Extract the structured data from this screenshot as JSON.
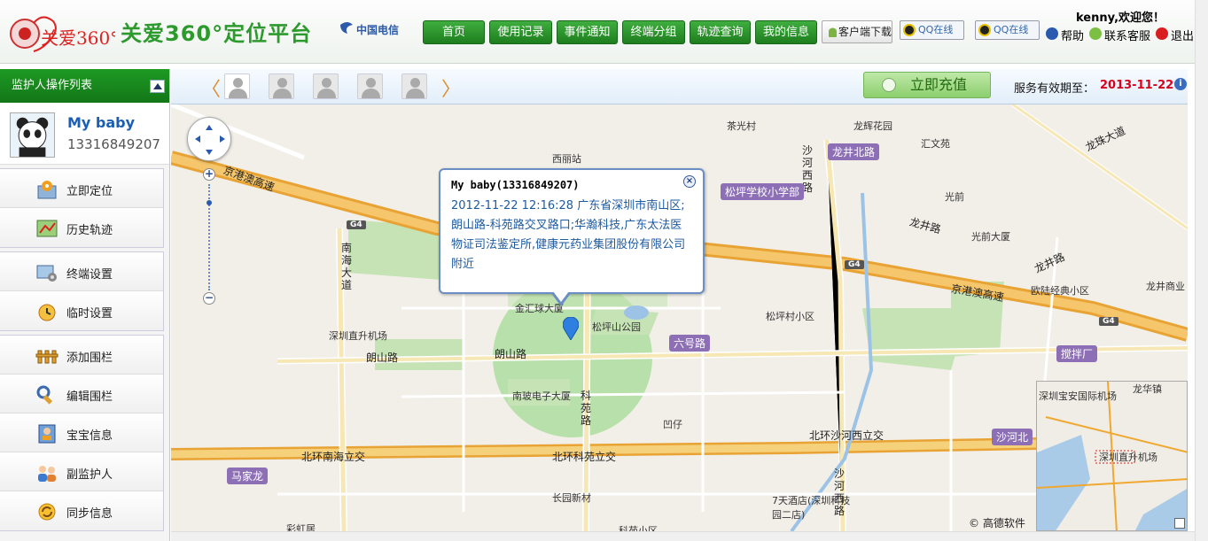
{
  "header": {
    "logo_text": "关爱360°",
    "site_title": "关爱360°定位平台",
    "telecom_logo_text": "中国电信",
    "nav": [
      "首页",
      "使用记录",
      "事件通知",
      "终端分组",
      "轨迹查询",
      "我的信息"
    ],
    "client_download": "客户端下载",
    "qq_online": [
      "QQ在线",
      "QQ在线"
    ],
    "welcome": "kenny,欢迎您！",
    "help": "帮助",
    "contact": "联系客服",
    "logout": "退出"
  },
  "sidebar": {
    "title": "监护人操作列表",
    "device": {
      "name": "My baby",
      "phone": "13316849207"
    },
    "groups": [
      [
        {
          "label": "立即定位",
          "icon": "locate-icon"
        },
        {
          "label": "历史轨迹",
          "icon": "history-map-icon"
        }
      ],
      [
        {
          "label": "终端设置",
          "icon": "device-settings-icon"
        },
        {
          "label": "临时设置",
          "icon": "temp-settings-icon"
        }
      ],
      [
        {
          "label": "添加围栏",
          "icon": "fence-add-icon"
        },
        {
          "label": "编辑围栏",
          "icon": "fence-edit-icon"
        },
        {
          "label": "宝宝信息",
          "icon": "baby-info-icon"
        },
        {
          "label": "副监护人",
          "icon": "guardian-icon"
        },
        {
          "label": "同步信息",
          "icon": "sync-icon"
        }
      ]
    ]
  },
  "toolbar": {
    "recharge": "立即充值",
    "service_label": "服务有效期至：",
    "service_date": "2013-11-22",
    "info": "i"
  },
  "popup": {
    "title": "My baby(13316849207)",
    "body": "2012-11-22 12:16:28 广东省深圳市南山区;朗山路-科苑路交叉路口;华瀚科技,广东太法医物证司法鉴定所,健康元药业集团股份有限公司附近"
  },
  "map": {
    "copyright": "© 高德软件",
    "poi": [
      "西丽站",
      "茶光村",
      "龙辉花园",
      "汇文苑",
      "光前",
      "光前大厦",
      "松坪村小区",
      "龙井商业",
      "欧陆经典小区",
      "金汇球大厦",
      "松坪山公园",
      "深圳直升机场",
      "南玻电子大厦",
      "凹仔",
      "长园新材",
      "7天酒店(深圳科技园二店)",
      "彩虹居",
      "科苑小区"
    ],
    "roads": [
      "京港澳高速",
      "京港澳高速",
      "朗山路",
      "朗山路",
      "北环南海立交",
      "北环科苑立交",
      "北环沙河西立交",
      "南海大道",
      "科苑路",
      "沙河西路",
      "龙井路",
      "龙井路",
      "龙珠大道",
      "沙河西路"
    ],
    "areas": [
      "龙井北路",
      "松坪学校小学部",
      "六号路",
      "搅拌厂",
      "马家龙",
      "沙河北"
    ],
    "highway_shields": [
      "G4",
      "G4",
      "G4"
    ],
    "overview_labels": [
      "深圳宝安国际机场",
      "龙华镇",
      "深圳直升机场"
    ]
  }
}
